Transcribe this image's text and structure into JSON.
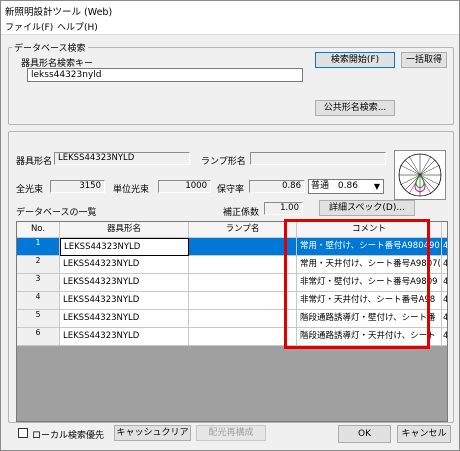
{
  "window": {
    "title": "新照明設計ツール (Web)"
  },
  "menu": {
    "file": "ファイル(F)",
    "help": "ヘルプ(H)"
  },
  "db_search": {
    "group_label": "データベース検索",
    "key_label": "器具形名検索キー",
    "key_value": "lekss44323nyld",
    "search_start": "検索開始(F)",
    "bulk_get": "一括取得",
    "public_search": "公共形名検索..."
  },
  "detail": {
    "fixture_label": "器具形名",
    "fixture_value": "LEKSS44323NYLD",
    "lamp_label": "ランプ形名",
    "lamp_value": "",
    "total_flux_label": "全光束",
    "total_flux_value": "3150",
    "unit_flux_label": "単位光束",
    "unit_flux_value": "1000",
    "maint_label": "保守率",
    "maint_value": "0.86",
    "maint_select_type": "普通",
    "maint_select_value": "0.86",
    "list_label": "データベースの一覧",
    "corr_label": "補正係数",
    "corr_value": "1.00",
    "spec_button": "詳細スペック(D)..."
  },
  "table": {
    "headers": {
      "no": "No.",
      "fixture": "器具形名",
      "lamp": "ランプ名",
      "comment": "コメント"
    },
    "rows": [
      {
        "no": "1",
        "fixture": "LEKSS44323NYLD",
        "lamp": "",
        "comment": "常用・壁付け、シート番号A980490",
        "extra": "4"
      },
      {
        "no": "2",
        "fixture": "LEKSS44323NYLD",
        "lamp": "",
        "comment": "常用・天井付け、シート番号A9807(",
        "extra": "4"
      },
      {
        "no": "3",
        "fixture": "LEKSS44323NYLD",
        "lamp": "",
        "comment": "非常灯・壁付け、シート番号A9809",
        "extra": "4"
      },
      {
        "no": "4",
        "fixture": "LEKSS44323NYLD",
        "lamp": "",
        "comment": "非常灯・天井付け、シート番号A98",
        "extra": "4"
      },
      {
        "no": "5",
        "fixture": "LEKSS44323NYLD",
        "lamp": "",
        "comment": "階段通路誘導灯・壁付け、シート番",
        "extra": "4"
      },
      {
        "no": "6",
        "fixture": "LEKSS44323NYLD",
        "lamp": "",
        "comment": "階段通路誘導灯・天井付け、シート",
        "extra": "4"
      }
    ]
  },
  "footer": {
    "local_search": "ローカル検索優先",
    "cache_clear": "キャッシュクリア",
    "light_rebuild": "配光再構成",
    "ok": "OK",
    "cancel": "キャンセル"
  },
  "colors": {
    "selection": "#0078d7",
    "highlight_box": "#e00000",
    "grid_bg": "#a0a0a0"
  }
}
